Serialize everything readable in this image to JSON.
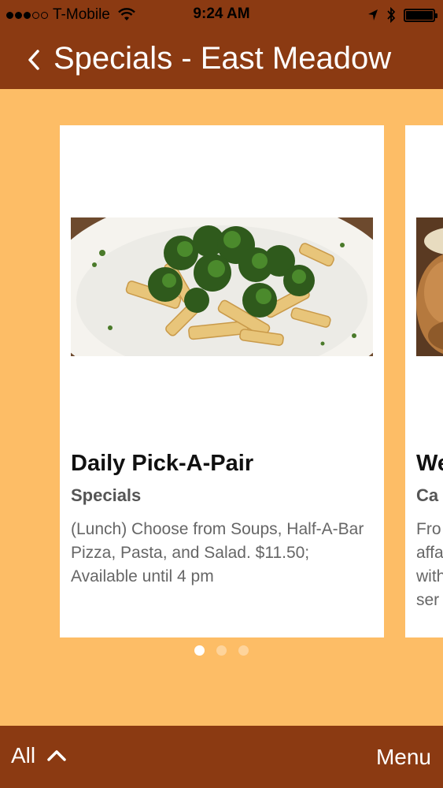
{
  "status_bar": {
    "carrier": "T-Mobile",
    "time": "9:24 AM",
    "signal_bars_filled": 3,
    "signal_bars_total": 5,
    "battery_level": 1.0
  },
  "nav": {
    "title": "Specials - East Meadow",
    "back_icon": "chevron-left-icon"
  },
  "cards": [
    {
      "title": "Daily Pick-A-Pair",
      "category": "Specials",
      "description": "(Lunch) Choose from Soups, Half-A-Bar Pizza, Pasta, and Salad. $11.50; Available until 4 pm",
      "image": "pasta-with-broccoli"
    },
    {
      "title": "We",
      "category": "Ca",
      "description_lines": [
        "Fro",
        "affa",
        "with",
        "ser"
      ],
      "image": "bread-bowl"
    }
  ],
  "pagination": {
    "current": 1,
    "total": 3
  },
  "footer": {
    "filter_label": "All",
    "filter_icon": "chevron-up-icon",
    "menu_label": "Menu"
  },
  "colors": {
    "header_bg": "#8b3a12",
    "page_bg": "#fdbd66",
    "card_bg": "#ffffff"
  }
}
